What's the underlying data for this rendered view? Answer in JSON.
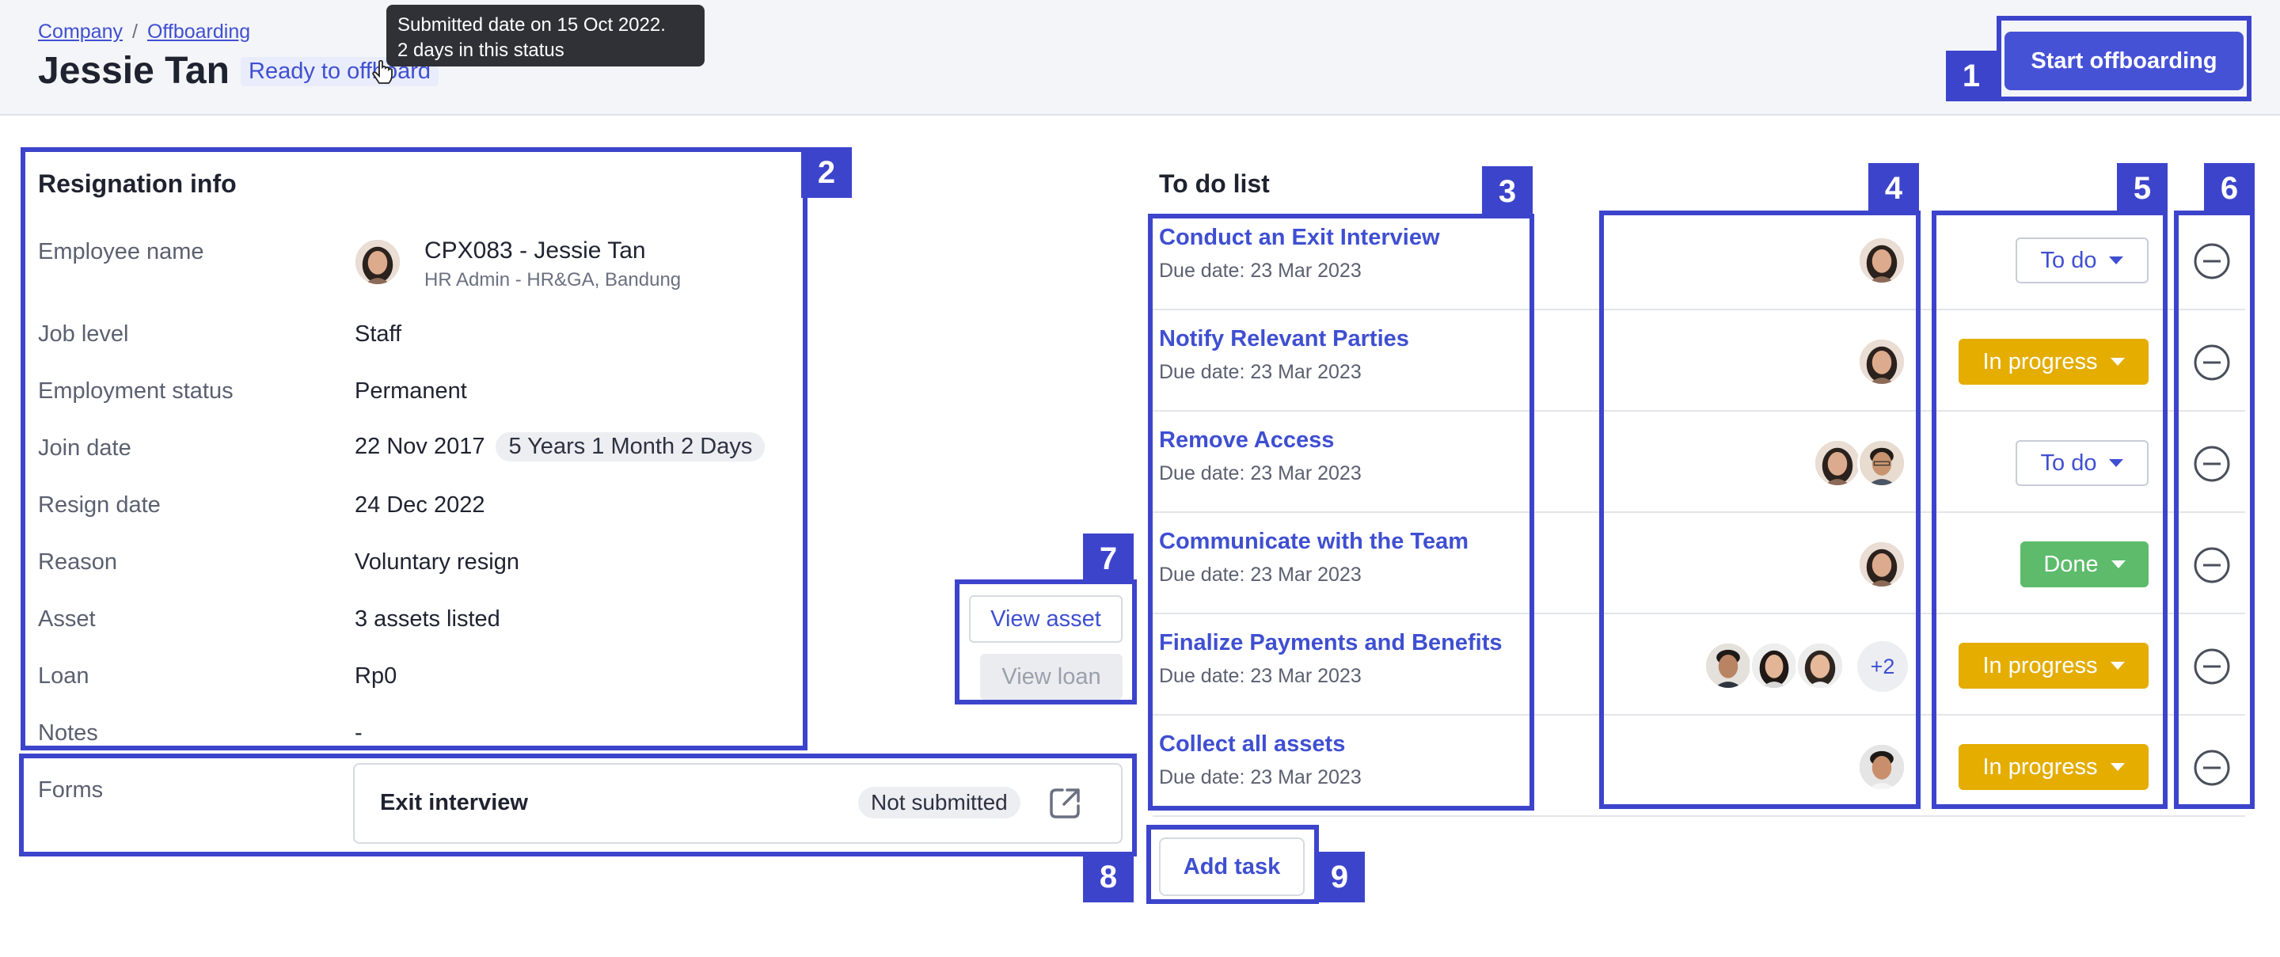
{
  "header": {
    "breadcrumb": [
      "Company",
      "Offboarding"
    ],
    "breadcrumb_sep": "/",
    "title": "Jessie Tan",
    "status": "Ready to offboard",
    "tooltip_line1": "Submitted date on 15 Oct 2022.",
    "tooltip_line2": "2 days in this status",
    "primary_action": "Start offboarding"
  },
  "resignation": {
    "title": "Resignation info",
    "employee_label": "Employee name",
    "employee_name": "CPX083 - Jessie Tan",
    "employee_sub": "HR Admin - HR&GA, Bandung",
    "fields": [
      {
        "label": "Job level",
        "value": "Staff"
      },
      {
        "label": "Employment status",
        "value": "Permanent"
      },
      {
        "label": "Join date",
        "value": "22 Nov 2017",
        "pill": "5 Years 1 Month 2 Days"
      },
      {
        "label": "Resign date",
        "value": "24 Dec 2022"
      },
      {
        "label": "Reason",
        "value": "Voluntary resign"
      },
      {
        "label": "Asset",
        "value": "3 assets listed"
      },
      {
        "label": "Loan",
        "value": "Rp0"
      },
      {
        "label": "Notes",
        "value": "-"
      }
    ],
    "view_asset": "View asset",
    "view_loan": "View loan",
    "forms_label": "Forms",
    "form_name": "Exit interview",
    "form_status": "Not submitted"
  },
  "todo": {
    "title": "To do list",
    "tasks": [
      {
        "title": "Conduct an Exit Interview",
        "due": "Due date: 23 Mar 2023",
        "status": "To do",
        "status_type": "todo"
      },
      {
        "title": "Notify Relevant Parties",
        "due": "Due date: 23 Mar 2023",
        "status": "In progress",
        "status_type": "progress"
      },
      {
        "title": "Remove Access",
        "due": "Due date: 23 Mar 2023",
        "status": "To do",
        "status_type": "todo"
      },
      {
        "title": "Communicate with the Team",
        "due": "Due date: 23 Mar 2023",
        "status": "Done",
        "status_type": "done"
      },
      {
        "title": "Finalize Payments and Benefits",
        "due": "Due date: 23 Mar 2023",
        "status": "In progress",
        "status_type": "progress",
        "more": "+2"
      },
      {
        "title": "Collect all assets",
        "due": "Due date: 23 Mar 2023",
        "status": "In progress",
        "status_type": "progress"
      }
    ],
    "add_task": "Add task"
  },
  "annotations": [
    "1",
    "2",
    "3",
    "4",
    "5",
    "6",
    "7",
    "8",
    "9"
  ],
  "colors": {
    "accent": "#3f4fd1",
    "annotation": "#3d44cc",
    "in_progress": "#e4ad00",
    "done": "#5dbb6b"
  }
}
